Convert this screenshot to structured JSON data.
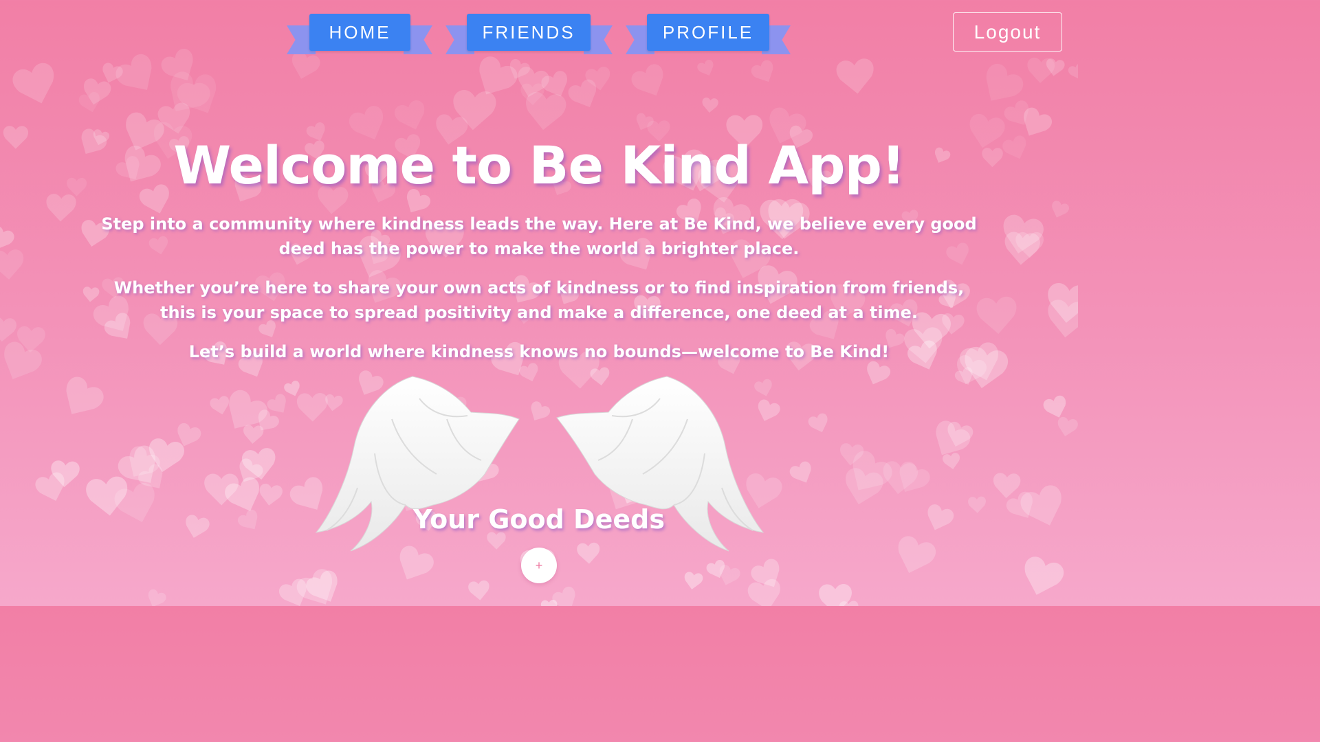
{
  "nav": {
    "items": [
      {
        "label": "HOME"
      },
      {
        "label": "FRIENDS"
      },
      {
        "label": "PROFILE"
      }
    ],
    "logout_label": "Logout"
  },
  "hero": {
    "title": "Welcome to Be Kind App!",
    "paragraphs": [
      "Step into a community where kindness leads the way. Here at Be Kind, we believe every good deed has the power to make the world a brighter place.",
      "Whether you’re here to share your own acts of kindness or to find inspiration from friends, this is your space to spread positivity and make a difference, one deed at a time.",
      "Let’s build a world where kindness knows no bounds—welcome to Be Kind!"
    ]
  },
  "deeds": {
    "title": "Your Good Deeds",
    "add_label": "+"
  },
  "colors": {
    "nav_button": "#3b82f2",
    "ribbon_tail": "#8c93ef",
    "background_top": "#f27fa6",
    "background_bottom": "#f6a8cb"
  },
  "icons": {
    "background": "heart-pattern",
    "decoration": "angel-wings-icon"
  }
}
